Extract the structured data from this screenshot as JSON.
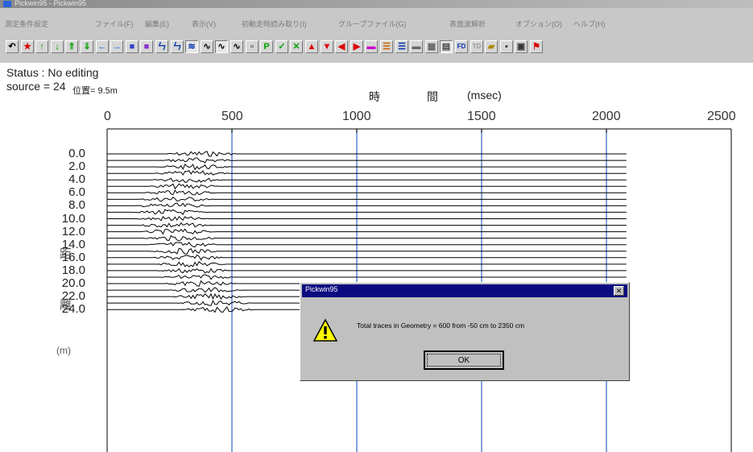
{
  "window": {
    "title": "Pickwin95 - Pickwin95"
  },
  "menu": [
    "測定条件設定",
    "ファイル(F)",
    "編集(E)",
    "表示(V)",
    "初動走時読み取り(I)",
    "グループファイル(G)",
    "表面波解析",
    "オプション(O)",
    "ヘルプ(H)"
  ],
  "toolbar": {
    "buttons": [
      {
        "icon": "undo-icon",
        "glyph": "↶",
        "color": "#000000"
      },
      {
        "icon": "star-icon",
        "glyph": "★",
        "color": "#d40000"
      },
      {
        "icon": "arrow-up-icon",
        "glyph": "↑",
        "color": "#00a000"
      },
      {
        "icon": "arrow-down-icon",
        "glyph": "↓",
        "color": "#00a000"
      },
      {
        "icon": "double-arrow-up-icon",
        "glyph": "⇑",
        "color": "#00a000"
      },
      {
        "icon": "double-arrow-down-icon",
        "glyph": "⇓",
        "color": "#00a000"
      },
      {
        "icon": "arrow-left-icon",
        "glyph": "←",
        "color": "#0066dd"
      },
      {
        "icon": "arrow-right-icon",
        "glyph": "→",
        "color": "#0066dd"
      },
      {
        "icon": "block-icon",
        "glyph": "■",
        "color": "#3344cc"
      },
      {
        "icon": "block-icon",
        "glyph": "■",
        "color": "#8833cc"
      },
      {
        "icon": "step-icon",
        "glyph": "ㄣ",
        "color": "#0033aa"
      },
      {
        "icon": "step-icon",
        "glyph": "ㄣ",
        "color": "#0033aa"
      },
      {
        "icon": "wiggle-icon",
        "glyph": "≋",
        "color": "#0033aa",
        "pressed": true
      },
      {
        "icon": "wave-icon",
        "glyph": "∿",
        "color": "#000000"
      },
      {
        "icon": "wave-icon",
        "glyph": "∿",
        "color": "#000000",
        "pressed": true
      },
      {
        "icon": "wave-icon",
        "glyph": "∿",
        "color": "#000000"
      },
      {
        "icon": "page-icon",
        "glyph": "▫",
        "color": "#000000"
      },
      {
        "icon": "pick-icon",
        "glyph": "P",
        "color": "#00a000"
      },
      {
        "icon": "check-icon",
        "glyph": "✓",
        "color": "#00a000"
      },
      {
        "icon": "cross-icon",
        "glyph": "✕",
        "color": "#00a000"
      },
      {
        "icon": "triangle-up-icon",
        "glyph": "▲",
        "color": "#dd0000"
      },
      {
        "icon": "triangle-down-icon",
        "glyph": "▼",
        "color": "#dd0000"
      },
      {
        "icon": "triangle-left-icon",
        "glyph": "◀",
        "color": "#dd0000"
      },
      {
        "icon": "triangle-right-icon",
        "glyph": "▶",
        "color": "#dd0000"
      },
      {
        "icon": "color-bar-icon",
        "glyph": "▬",
        "color": "#cc00cc"
      },
      {
        "icon": "color-bar-icon",
        "glyph": "☰",
        "color": "#cc6600"
      },
      {
        "icon": "color-bar-icon",
        "glyph": "☰",
        "color": "#0033aa"
      },
      {
        "icon": "bar-icon",
        "glyph": "▬",
        "color": "#666666"
      },
      {
        "icon": "grid-icon",
        "glyph": "▦",
        "color": "#666666"
      },
      {
        "icon": "chart-icon",
        "glyph": "▤",
        "color": "#444444",
        "pressed": true
      },
      {
        "icon": "fd-icon",
        "glyph": "FD",
        "color": "#0033aa"
      },
      {
        "icon": "td-icon",
        "glyph": "TD",
        "color": "#999999"
      },
      {
        "icon": "open-folder-icon",
        "glyph": "▰",
        "color": "#b08a00"
      },
      {
        "icon": "save-icon",
        "glyph": "▪",
        "color": "#333333"
      },
      {
        "icon": "print-icon",
        "glyph": "▣",
        "color": "#333333"
      },
      {
        "icon": "exit-icon",
        "glyph": "⚑",
        "color": "#dd0000"
      }
    ]
  },
  "status": {
    "line1": "Status : No editing",
    "source": "source = 24",
    "position": "位置= 9.5m"
  },
  "chart_data": {
    "type": "line",
    "x_axis_title": [
      "時",
      "間",
      "(msec)"
    ],
    "y_axis_title": [
      "距",
      "離",
      "(m)"
    ],
    "x_ticks": [
      0,
      500,
      1000,
      1500,
      2000,
      2500
    ],
    "xlim": [
      0,
      2500
    ],
    "y_ticks": [
      "0.0",
      "2.0",
      "4.0",
      "6.0",
      "8.0",
      "10.0",
      "12.0",
      "14.0",
      "16.0",
      "18.0",
      "20.0",
      "22.0",
      "24.0"
    ],
    "trace_distances_m": [
      0,
      1,
      2,
      3,
      4,
      5,
      6,
      7,
      8,
      9,
      10,
      11,
      12,
      13,
      14,
      15,
      16,
      17,
      18,
      19,
      20,
      21,
      22,
      23,
      24
    ],
    "first_arrivals_msec": [
      270,
      255,
      240,
      230,
      215,
      200,
      185,
      165,
      150,
      145,
      150,
      160,
      175,
      185,
      195,
      205,
      215,
      225,
      235,
      250,
      265,
      285,
      300,
      320,
      340
    ],
    "trace_end_msec": 2080,
    "grid_x": [
      500,
      1000,
      1500,
      2000
    ],
    "grid_color": "#3f6fd0"
  },
  "dialog": {
    "title": "Pickwin95",
    "message": "Total traces in Geometry = 600 from -50 cm to 2350 cm",
    "ok_label": "OK"
  }
}
